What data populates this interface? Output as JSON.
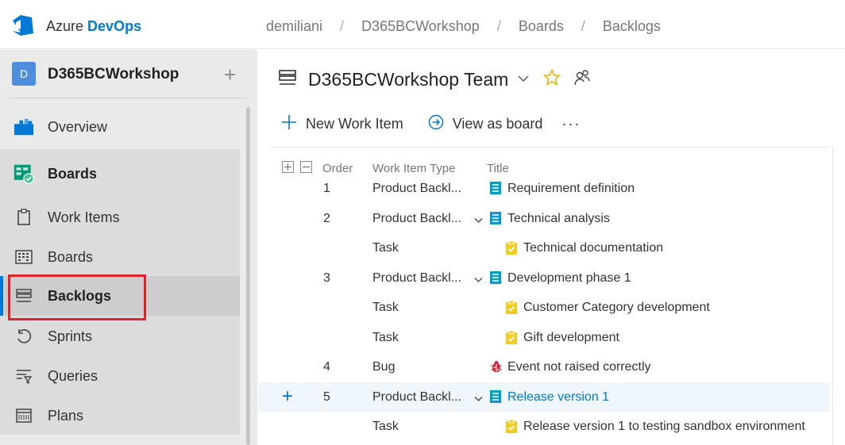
{
  "header": {
    "brand_prefix": "Azure",
    "brand_name": "DevOps",
    "breadcrumb": [
      "demiliani",
      "D365BCWorkshop",
      "Boards",
      "Backlogs"
    ]
  },
  "sidebar": {
    "project_initial": "D",
    "project_name": "D365BCWorkshop",
    "items": [
      {
        "label": "Overview",
        "icon": "overview-icon"
      },
      {
        "label": "Boards",
        "icon": "boards-hub-icon"
      },
      {
        "label": "Work Items",
        "icon": "work-items-icon"
      },
      {
        "label": "Boards",
        "icon": "boards-icon"
      },
      {
        "label": "Backlogs",
        "icon": "backlogs-icon"
      },
      {
        "label": "Sprints",
        "icon": "sprints-icon"
      },
      {
        "label": "Queries",
        "icon": "queries-icon"
      },
      {
        "label": "Plans",
        "icon": "plans-icon"
      }
    ]
  },
  "main": {
    "team_name": "D365BCWorkshop Team",
    "toolbar": {
      "new_work_item": "New Work Item",
      "view_as_board": "View as board",
      "more": "···"
    },
    "columns": {
      "order": "Order",
      "type": "Work Item Type",
      "title": "Title"
    },
    "rows": [
      {
        "order": "1",
        "type": "Product Backl...",
        "title": "Requirement definition",
        "kind": "pbi",
        "expandable": false,
        "child": false
      },
      {
        "order": "2",
        "type": "Product Backl...",
        "title": "Technical analysis",
        "kind": "pbi",
        "expandable": true,
        "child": false
      },
      {
        "order": "",
        "type": "Task",
        "title": "Technical documentation",
        "kind": "task",
        "expandable": false,
        "child": true
      },
      {
        "order": "3",
        "type": "Product Backl...",
        "title": "Development phase 1",
        "kind": "pbi",
        "expandable": true,
        "child": false
      },
      {
        "order": "",
        "type": "Task",
        "title": "Customer Category development",
        "kind": "task",
        "expandable": false,
        "child": true
      },
      {
        "order": "",
        "type": "Task",
        "title": "Gift development",
        "kind": "task",
        "expandable": false,
        "child": true
      },
      {
        "order": "4",
        "type": "Bug",
        "title": "Event not raised correctly",
        "kind": "bug",
        "expandable": false,
        "child": false
      },
      {
        "order": "5",
        "type": "Product Backl...",
        "title": "Release version 1",
        "kind": "pbi",
        "expandable": true,
        "child": false,
        "selected": true
      },
      {
        "order": "",
        "type": "Task",
        "title": "Release version 1 to testing sandbox environment",
        "kind": "task",
        "expandable": false,
        "child": true
      }
    ]
  },
  "colors": {
    "accent": "#0078d4",
    "pbi": "#009ccc",
    "task": "#f2cb1d",
    "bug": "#cc293d",
    "highlight": "#e0202a",
    "star": "#e8b10c"
  }
}
